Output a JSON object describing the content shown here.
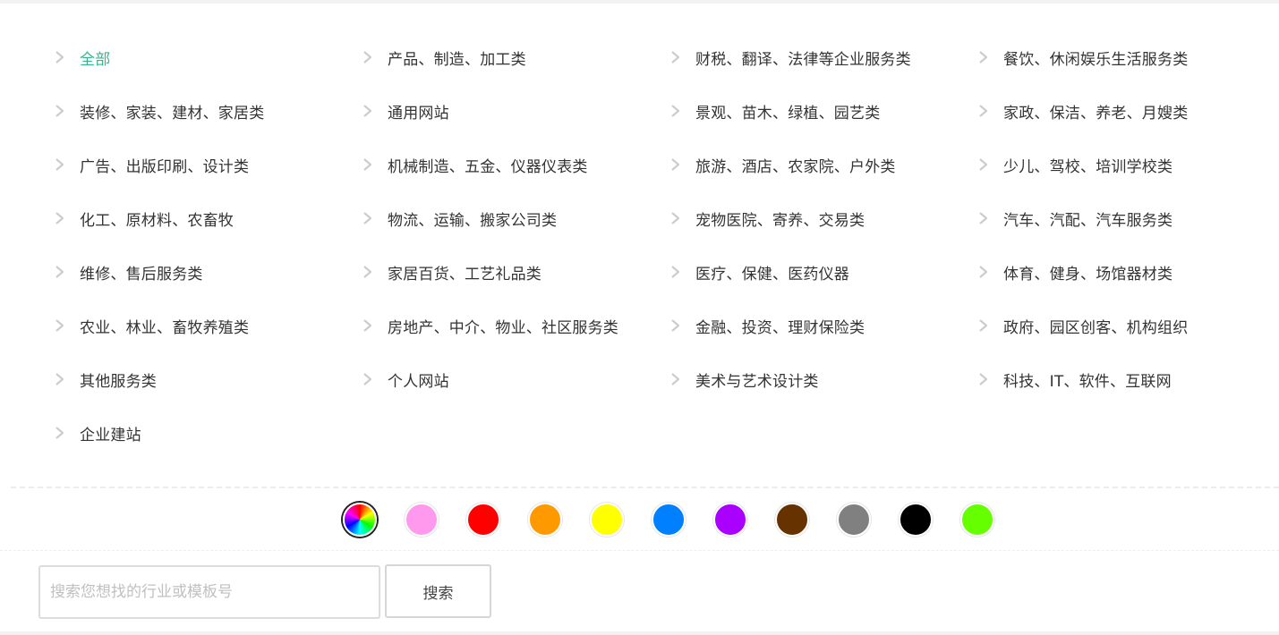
{
  "categories": [
    {
      "label": "全部",
      "active": true
    },
    {
      "label": "产品、制造、加工类"
    },
    {
      "label": "财税、翻译、法律等企业服务类"
    },
    {
      "label": "餐饮、休闲娱乐生活服务类"
    },
    {
      "label": "装修、家装、建材、家居类"
    },
    {
      "label": "通用网站"
    },
    {
      "label": "景观、苗木、绿植、园艺类"
    },
    {
      "label": "家政、保洁、养老、月嫂类"
    },
    {
      "label": "广告、出版印刷、设计类"
    },
    {
      "label": "机械制造、五金、仪器仪表类"
    },
    {
      "label": "旅游、酒店、农家院、户外类"
    },
    {
      "label": "少儿、驾校、培训学校类"
    },
    {
      "label": "化工、原材料、农畜牧"
    },
    {
      "label": "物流、运输、搬家公司类"
    },
    {
      "label": "宠物医院、寄养、交易类"
    },
    {
      "label": "汽车、汽配、汽车服务类"
    },
    {
      "label": "维修、售后服务类"
    },
    {
      "label": "家居百货、工艺礼品类"
    },
    {
      "label": "医疗、保健、医药仪器"
    },
    {
      "label": "体育、健身、场馆器材类"
    },
    {
      "label": "农业、林业、畜牧养殖类"
    },
    {
      "label": "房地产、中介、物业、社区服务类"
    },
    {
      "label": "金融、投资、理财保险类"
    },
    {
      "label": "政府、园区创客、机构组织"
    },
    {
      "label": "其他服务类"
    },
    {
      "label": "个人网站"
    },
    {
      "label": "美术与艺术设计类"
    },
    {
      "label": "科技、IT、软件、互联网"
    },
    {
      "label": "企业建站"
    }
  ],
  "colors": {
    "accent": "#35b58e",
    "chevron": "#cccccc",
    "swatches": [
      "all",
      "#ff99ee",
      "#ff0000",
      "#ff9900",
      "#ffff00",
      "#0080ff",
      "#aa00ff",
      "#663300",
      "#808080",
      "#000000",
      "#66ff00"
    ]
  },
  "search": {
    "placeholder": "搜索您想找的行业或模板号",
    "value": "",
    "button_label": "搜索"
  }
}
